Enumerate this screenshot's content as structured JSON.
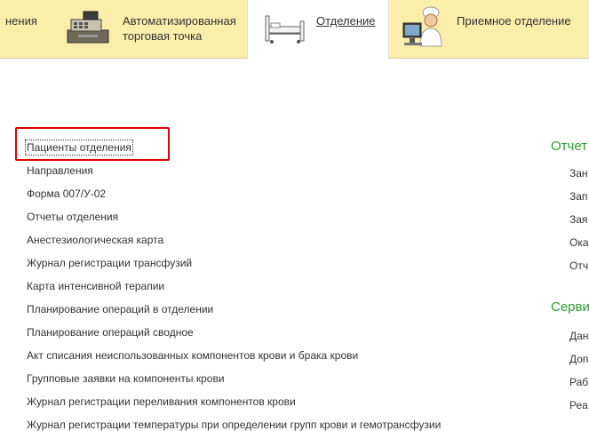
{
  "tabs": [
    {
      "label": "нения"
    },
    {
      "label_line1": "Автоматизированная",
      "label_line2": "торговая точка"
    },
    {
      "label": "Отделение"
    },
    {
      "label": "Приемное отделение"
    }
  ],
  "links": [
    "Пациенты отделения",
    "Направления",
    "Форма 007/У-02",
    "Отчеты отделения",
    "Анестезиологическая карта",
    "Журнал регистрации трансфузий",
    "Карта интенсивной терапии",
    "Планирование операций в отделении",
    "Планирование операций сводное",
    "Акт списания неиспользованных компонентов крови и брака крови",
    "Групповые заявки на компоненты крови",
    "Журнал регистрации переливания компонентов крови",
    "Журнал регистрации температуры при определении групп крови и гемотрансфузии"
  ],
  "right": {
    "section1_title": "Отчет",
    "section1_items": [
      "Зан",
      "Зап",
      "Зая",
      "Ока",
      "Отч"
    ],
    "section2_title": "Серви",
    "section2_items": [
      "Дан",
      "Доп",
      "Раб",
      "Реа"
    ]
  },
  "colors": {
    "topbar": "#fbeeaa",
    "section_title": "#2e9b2e",
    "highlight": "#e00000"
  }
}
